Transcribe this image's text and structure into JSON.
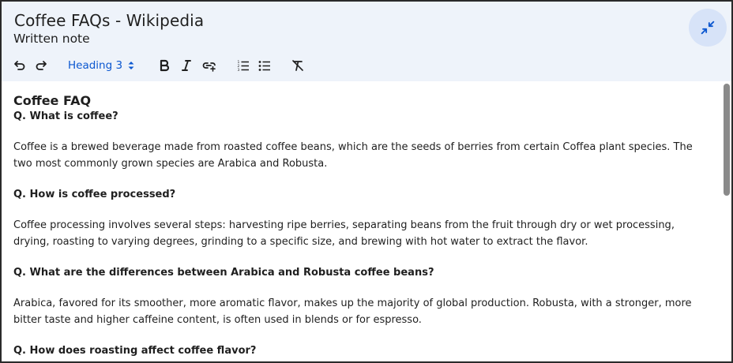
{
  "header": {
    "title": "Coffee FAQs - Wikipedia",
    "subtitle": "Written note"
  },
  "icons": {
    "collapse": "collapse-arrows-icon",
    "undo": "undo-icon",
    "redo": "redo-icon",
    "bold": "bold-icon",
    "italic": "italic-icon",
    "link": "insert-link-icon",
    "numbered_list": "numbered-list-icon",
    "bulleted_list": "bulleted-list-icon",
    "clear_format": "clear-formatting-icon",
    "dropdown": "select-arrows-icon"
  },
  "toolbar": {
    "text_style": "Heading 3"
  },
  "colors": {
    "header_bg": "#eef3fa",
    "accent": "#0b57d0",
    "collapse_btn_bg": "#d7e3f8"
  },
  "content": {
    "heading": "Coffee FAQ",
    "faqs": [
      {
        "question": "Q. What is coffee?",
        "answer": "Coffee is a brewed beverage made from roasted coffee beans, which are the seeds of berries from certain Coffea plant species. The two most commonly grown species are Arabica and Robusta."
      },
      {
        "question": "Q. How is coffee processed?",
        "answer": "Coffee processing involves several steps: harvesting ripe berries, separating beans from the fruit through dry or wet processing, drying, roasting to varying degrees, grinding to a specific size, and brewing with hot water to extract the flavor."
      },
      {
        "question": "Q. What are the differences between Arabica and Robusta coffee beans?",
        "answer": "Arabica, favored for its smoother, more aromatic flavor, makes up the majority of global production. Robusta, with a stronger, more bitter taste and higher caffeine content, is often used in blends or for espresso."
      },
      {
        "question": "Q. How does roasting affect coffee flavor?",
        "answer": ""
      }
    ]
  }
}
